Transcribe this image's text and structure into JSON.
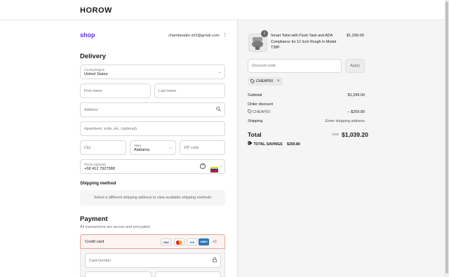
{
  "header": {
    "brand": "HOROW"
  },
  "account": {
    "shop_logo": "shop",
    "email": "chambeador.x02@gmail.com",
    "menu_icon": "kebab-icon"
  },
  "delivery": {
    "title": "Delivery",
    "country_label": "Country/Region",
    "country_value": "United States",
    "first_name_placeholder": "First name",
    "last_name_placeholder": "Last name",
    "address_placeholder": "Address",
    "apartment_placeholder": "Apartment, suite, etc. (optional)",
    "city_placeholder": "City",
    "state_label": "State",
    "state_value": "Alabama",
    "zip_placeholder": "ZIP code",
    "phone_label": "Phone (optional)",
    "phone_value": "+58 412 7927588"
  },
  "shipping_method": {
    "title": "Shipping method",
    "message": "Select a different shipping address to view available shipping methods"
  },
  "payment": {
    "title": "Payment",
    "subtitle": "All transactions are secure and encrypted.",
    "credit_card_label": "Credit card",
    "cards": [
      "VISA",
      "MC",
      "JCB",
      "AMEX"
    ],
    "more_cards": "+3",
    "card_number_placeholder": "Card number"
  },
  "order": {
    "quantity_badge": "1",
    "product_name": "Smart Toilet with Flush Tank and ADA Compliance for 12 Inch Rough In Model T38P",
    "product_price": "$1,299.00",
    "discount_placeholder": "Discount code",
    "apply_label": "Apply",
    "applied_code": "CHEAP50",
    "subtotal_label": "Subtotal",
    "subtotal_value": "$1,299.00",
    "order_discount_label": "Order discount",
    "discount_code": "CHEAP50",
    "discount_value": "– $259.80",
    "shipping_label": "Shipping",
    "shipping_value": "Enter shipping address",
    "total_label": "Total",
    "currency": "USD",
    "total_value": "$1,039.20",
    "savings_label": "TOTAL SAVINGS",
    "savings_value": "$259.80"
  },
  "colors": {
    "shop_purple": "#5a31f4",
    "error_border": "#e6a49b"
  }
}
